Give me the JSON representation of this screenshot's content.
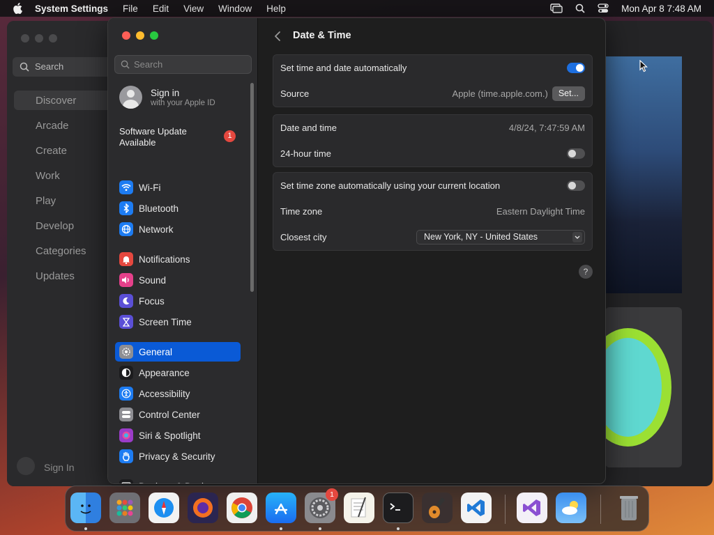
{
  "menubar": {
    "app_name": "System Settings",
    "menus": [
      "File",
      "Edit",
      "View",
      "Window",
      "Help"
    ],
    "clock": "Mon Apr 8  7:48 AM",
    "icons": [
      "apple-icon",
      "screen-mirroring-icon",
      "search-icon",
      "control-center-icon"
    ]
  },
  "background_app": {
    "search_placeholder": "Search",
    "nav": [
      "Discover",
      "Arcade",
      "Create",
      "Work",
      "Play",
      "Develop",
      "Categories",
      "Updates"
    ],
    "signin": "Sign In"
  },
  "settings": {
    "search_placeholder": "Search",
    "account": {
      "title": "Sign in",
      "subtitle": "with your Apple ID"
    },
    "update": {
      "text": "Software Update Available",
      "badge": "1"
    },
    "sidebar": [
      {
        "label": "Wi-Fi",
        "icon": "wifi-icon",
        "color": "#1d7cf2"
      },
      {
        "label": "Bluetooth",
        "icon": "bluetooth-icon",
        "color": "#1d7cf2"
      },
      {
        "label": "Network",
        "icon": "network-globe-icon",
        "color": "#1d7cf2"
      },
      {
        "label": "Notifications",
        "icon": "bell-icon",
        "color": "#e5483f"
      },
      {
        "label": "Sound",
        "icon": "speaker-icon",
        "color": "#e5408a"
      },
      {
        "label": "Focus",
        "icon": "moon-icon",
        "color": "#5b4fd6"
      },
      {
        "label": "Screen Time",
        "icon": "hourglass-icon",
        "color": "#5b4fd6"
      },
      {
        "label": "General",
        "icon": "gear-icon",
        "color": "#8e8e93",
        "selected": true
      },
      {
        "label": "Appearance",
        "icon": "appearance-icon",
        "color": "#1c1c1e"
      },
      {
        "label": "Accessibility",
        "icon": "accessibility-icon",
        "color": "#1d7cf2"
      },
      {
        "label": "Control Center",
        "icon": "control-center-icon",
        "color": "#8e8e93"
      },
      {
        "label": "Siri & Spotlight",
        "icon": "siri-icon",
        "color": "#9b3cc9"
      },
      {
        "label": "Privacy & Security",
        "icon": "hand-icon",
        "color": "#1d7cf2"
      },
      {
        "label": "Desktop & Dock",
        "icon": "desktop-dock-icon",
        "color": "#1c1c1e"
      }
    ],
    "page_title": "Date & Time",
    "group1": {
      "auto_label": "Set time and date automatically",
      "auto_on": true,
      "source_label": "Source",
      "source_value": "Apple (time.apple.com.)",
      "set_button": "Set..."
    },
    "group2": {
      "datetime_label": "Date and time",
      "datetime_value": "4/8/24, 7:47:59 AM",
      "hour24_label": "24-hour time",
      "hour24_on": false
    },
    "group3": {
      "tz_auto_label": "Set time zone automatically using your current location",
      "tz_auto_on": false,
      "tz_label": "Time zone",
      "tz_value": "Eastern Daylight Time",
      "city_label": "Closest city",
      "city_value": "New York, NY - United States"
    },
    "help": "?"
  },
  "dock": {
    "items": [
      "Finder",
      "Launchpad",
      "Safari",
      "Firefox",
      "Chrome",
      "App Store",
      "System Settings",
      "TextEdit",
      "Terminal",
      "GarageBand",
      "Visual Studio Code",
      "Visual Studio",
      "Weather",
      "Trash"
    ],
    "settings_badge": "1"
  }
}
